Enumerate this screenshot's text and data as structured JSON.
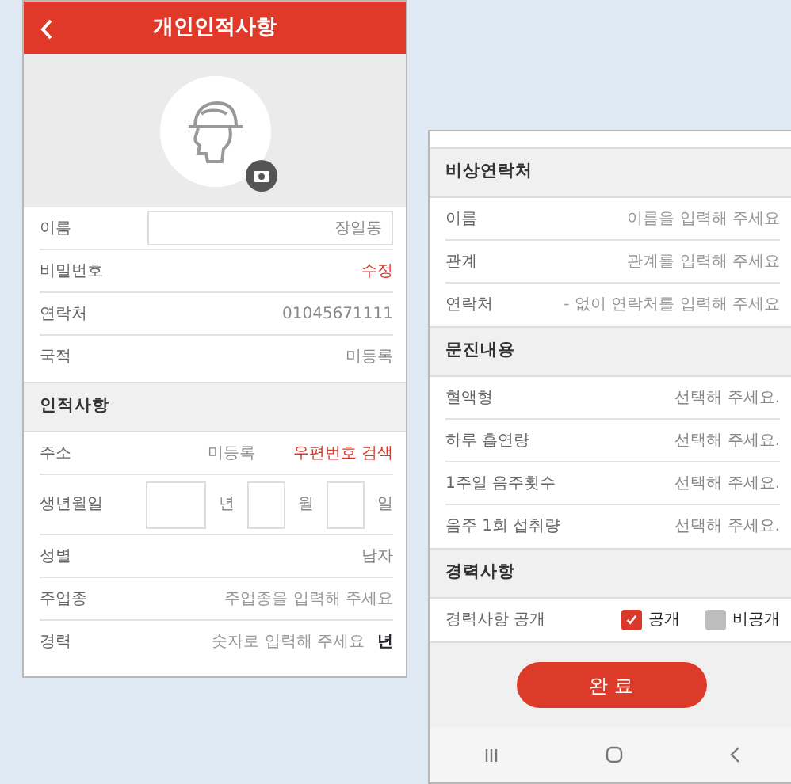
{
  "left_screen": {
    "header": {
      "title": "개인인적사항"
    },
    "profile_rows": [
      {
        "kind": "boxed",
        "label": "이름",
        "value": "장일동"
      },
      {
        "kind": "action",
        "label": "비밀번호",
        "action": "수정"
      },
      {
        "kind": "text",
        "label": "연락처",
        "value": "01045671111"
      },
      {
        "kind": "text",
        "label": "국적",
        "value": "미등록"
      }
    ],
    "section": {
      "title": "인적사항",
      "rows": [
        {
          "kind": "address",
          "label": "주소",
          "value": "미등록",
          "action": "우편번호 검색"
        },
        {
          "kind": "date",
          "label": "생년월일",
          "units": [
            "년",
            "월",
            "일"
          ]
        },
        {
          "kind": "text",
          "label": "성별",
          "value": "남자"
        },
        {
          "kind": "placeholder",
          "label": "주업종",
          "placeholder": "주업종을 입력해 주세요"
        },
        {
          "kind": "unit",
          "label": "경력",
          "placeholder": "숫자로 입력해 주세요",
          "unit": "년"
        }
      ]
    }
  },
  "right_screen": {
    "sections": [
      {
        "title": "비상연락처",
        "rows": [
          {
            "kind": "placeholder",
            "label": "이름",
            "placeholder": "이름을 입력해 주세요"
          },
          {
            "kind": "placeholder",
            "label": "관계",
            "placeholder": "관계를 입력해 주세요"
          },
          {
            "kind": "placeholder",
            "label": "연락처",
            "placeholder": "- 없이 연락처를 입력해 주세요"
          }
        ]
      },
      {
        "title": "문진내용",
        "rows": [
          {
            "kind": "select",
            "label": "혈액형",
            "placeholder": "선택해 주세요."
          },
          {
            "kind": "select",
            "label": "하루 흡연량",
            "placeholder": "선택해 주세요."
          },
          {
            "kind": "select",
            "label": "1주일 음주횟수",
            "placeholder": "선택해 주세요."
          },
          {
            "kind": "select",
            "label": "음주 1회 섭취량",
            "placeholder": "선택해 주세요."
          }
        ]
      },
      {
        "title": "경력사항",
        "rows": [
          {
            "kind": "checks",
            "label": "경력사항 공개",
            "options": [
              {
                "label": "공개",
                "checked": true
              },
              {
                "label": "비공개",
                "checked": false
              }
            ]
          }
        ]
      }
    ],
    "submit_button": "완 료"
  }
}
